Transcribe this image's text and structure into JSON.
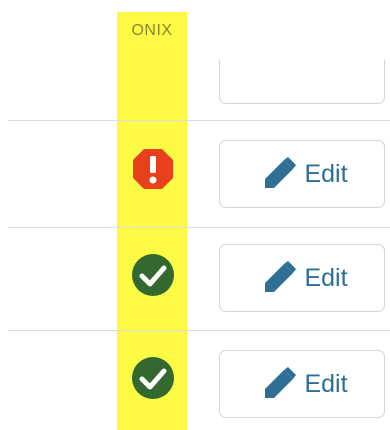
{
  "column": {
    "header": "ONIX"
  },
  "rows": [
    {
      "status": "error",
      "status_icon": "exclamation-octagon-icon",
      "status_color": "#e8401c",
      "edit_label": "Edit"
    },
    {
      "status": "ok",
      "status_icon": "check-circle-icon",
      "status_color": "#33682f",
      "edit_label": "Edit"
    },
    {
      "status": "ok",
      "status_icon": "check-circle-icon",
      "status_color": "#33682f",
      "edit_label": "Edit"
    }
  ],
  "colors": {
    "highlight": "#fdfa46",
    "accent": "#2f6f96",
    "border": "#d0d6da"
  }
}
